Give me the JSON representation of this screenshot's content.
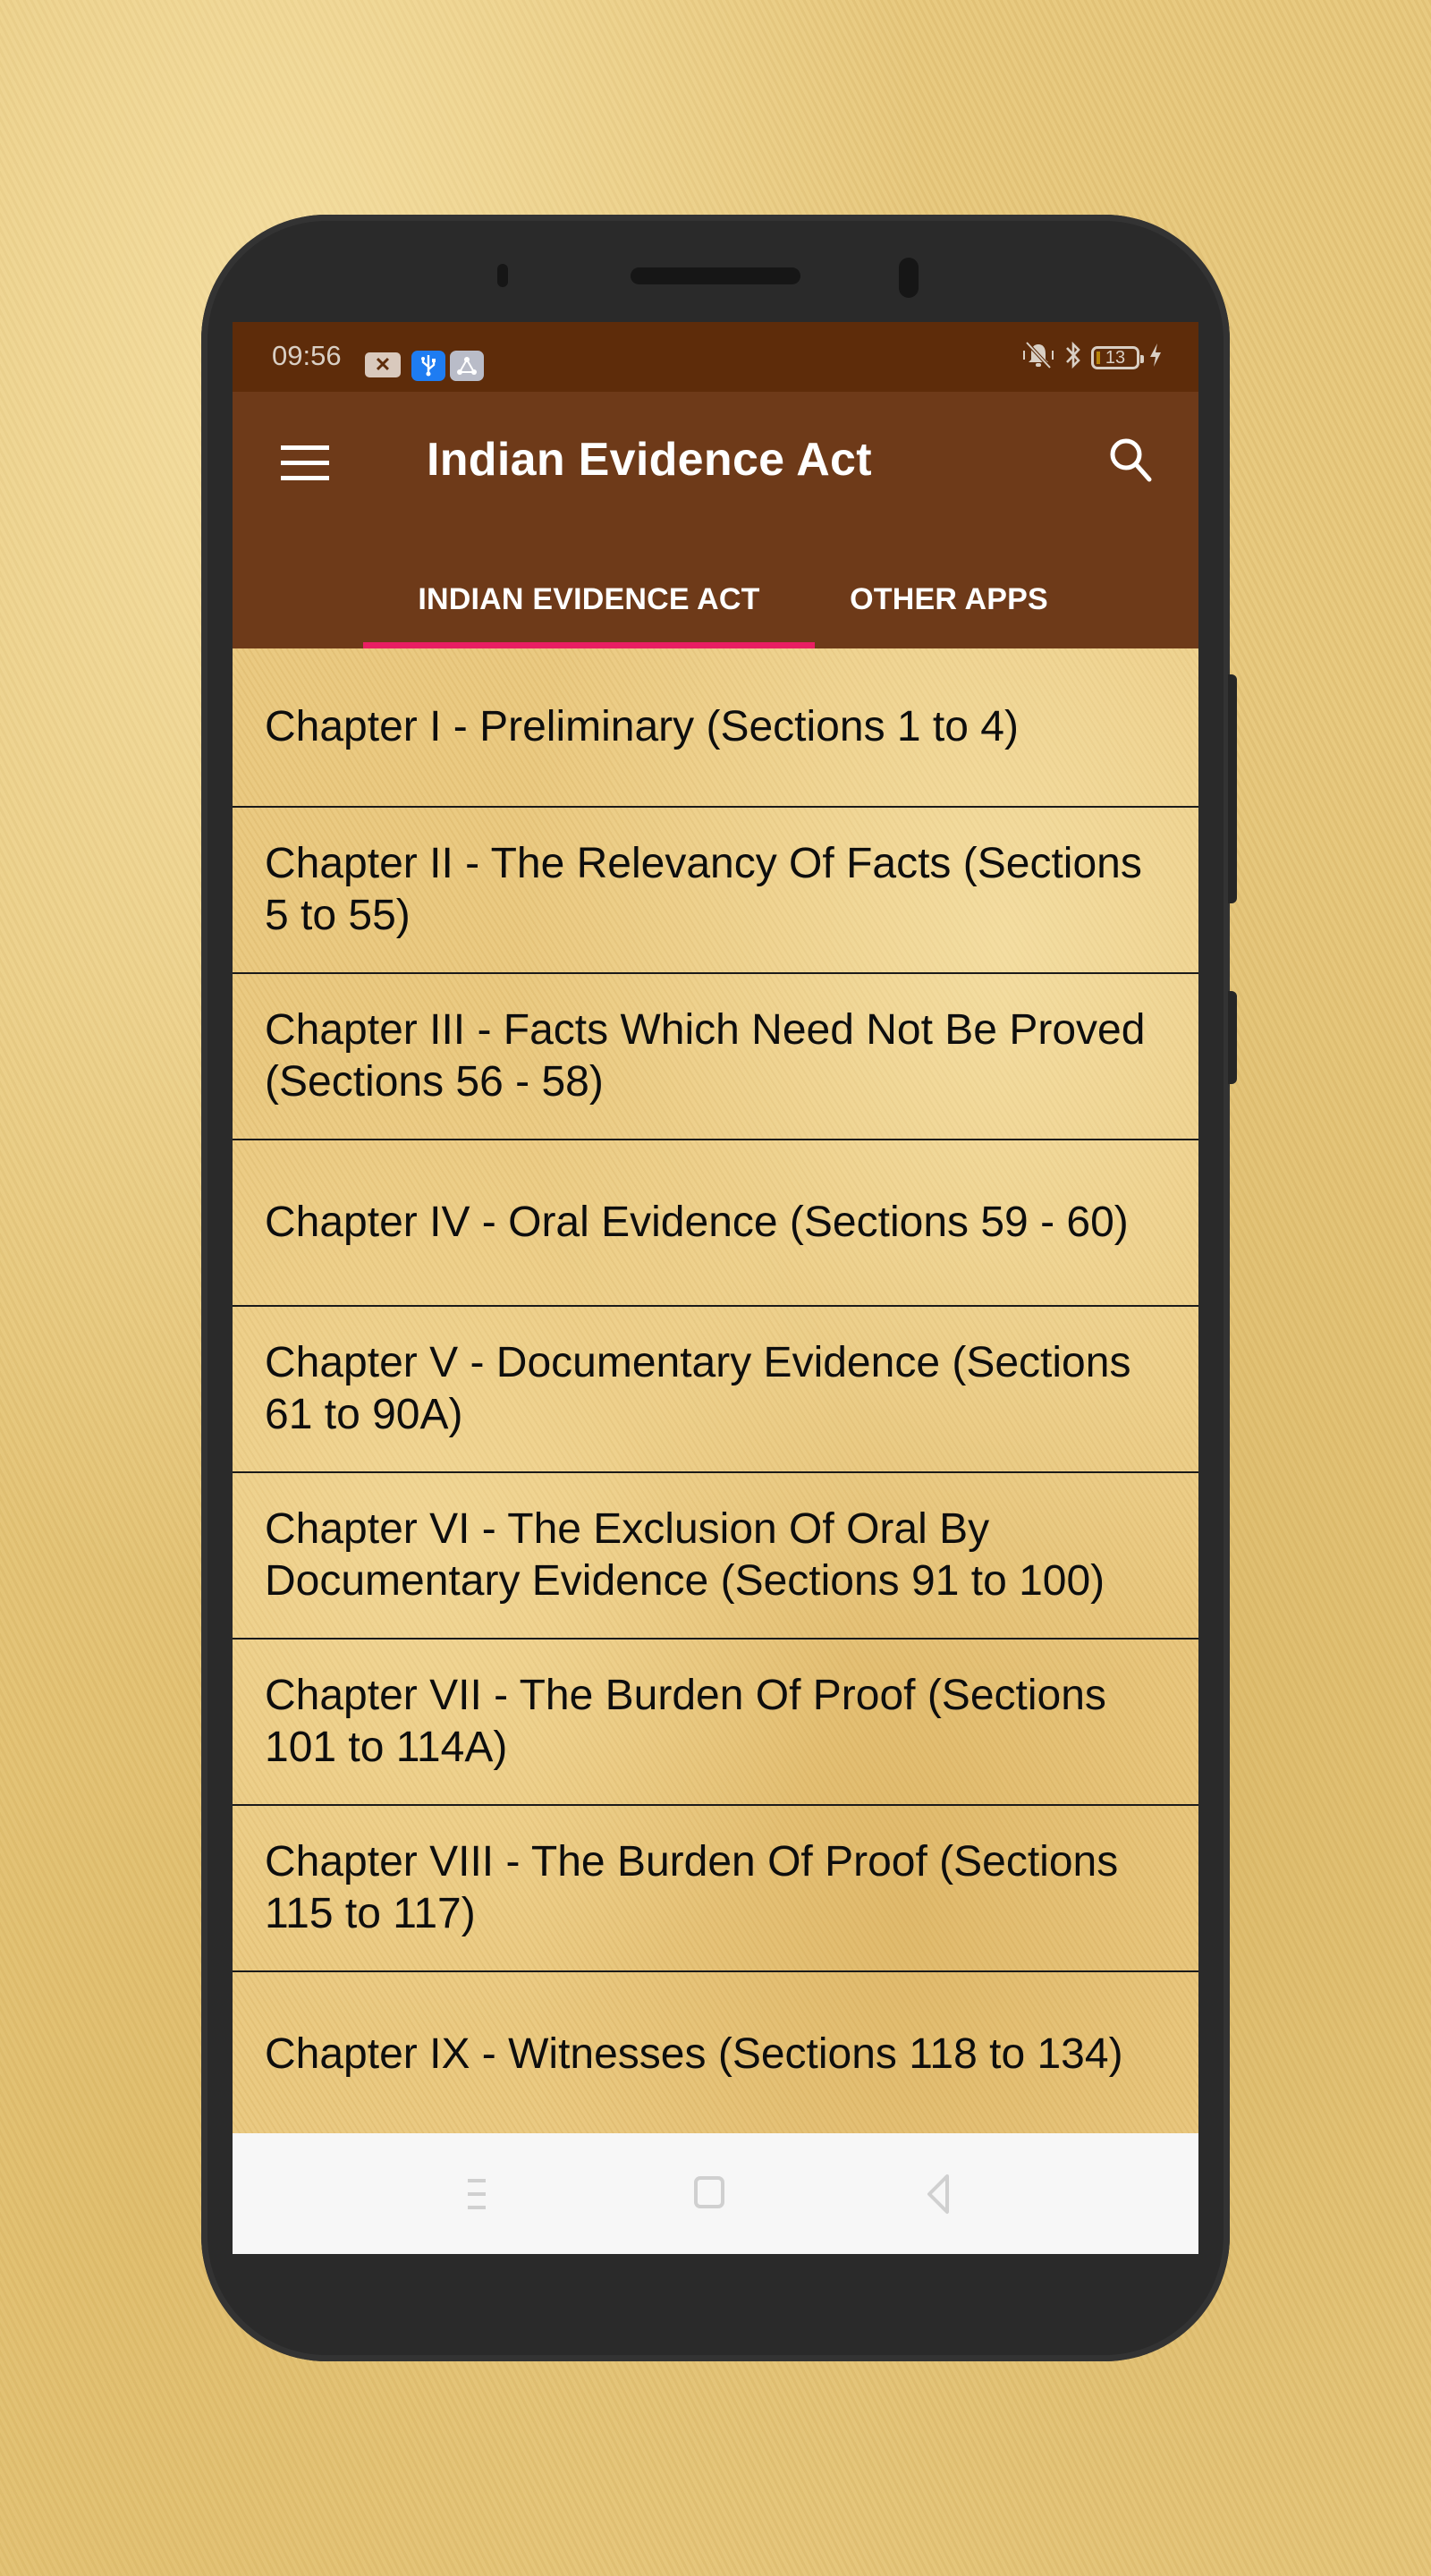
{
  "status_bar": {
    "time": "09:56",
    "left_icons": [
      "notification-x-icon",
      "usb-icon",
      "share-icon"
    ],
    "right_icons": [
      "vibrate-silent-icon",
      "bluetooth-icon",
      "battery-icon",
      "charging-icon"
    ],
    "battery_level": "13"
  },
  "app_bar": {
    "title": "Indian Evidence Act",
    "menu_icon": "hamburger-menu-icon",
    "search_icon": "search-icon"
  },
  "tabs": [
    {
      "label": "INDIAN EVIDENCE ACT",
      "active": true
    },
    {
      "label": "OTHER APPS",
      "active": false
    }
  ],
  "chapters": [
    {
      "label": "Chapter I - Preliminary (Sections 1 to 4)"
    },
    {
      "label": "Chapter II - The Relevancy Of Facts (Sections 5 to 55)"
    },
    {
      "label": "Chapter III - Facts Which Need Not Be Proved (Sections 56 - 58)"
    },
    {
      "label": "Chapter IV - Oral Evidence (Sections 59 - 60)"
    },
    {
      "label": "Chapter V - Documentary Evidence (Sections 61 to 90A)"
    },
    {
      "label": "Chapter VI - The Exclusion Of Oral By Documentary Evidence (Sections 91 to 100)"
    },
    {
      "label": "Chapter VII - The Burden Of Proof (Sections 101 to 114A)"
    },
    {
      "label": "Chapter VIII - The Burden Of Proof (Sections 115 to 117)"
    },
    {
      "label": "Chapter IX - Witnesses (Sections 118 to 134)"
    }
  ],
  "nav_bar": {
    "buttons": [
      "recent-apps-icon",
      "home-icon",
      "back-icon"
    ]
  },
  "colors": {
    "status_bar": "#5e2c0a",
    "app_bar": "#6e3a19",
    "tab_indicator": "#e91e63",
    "list_background": "#e9c77e",
    "nav_bar": "#f7f7f7"
  }
}
